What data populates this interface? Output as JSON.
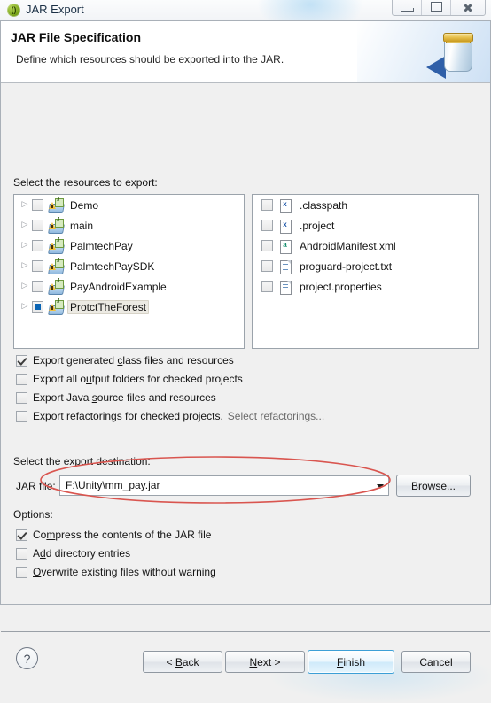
{
  "window": {
    "title": "JAR Export",
    "icon": "eclipse-icon",
    "controls": {
      "minimize": "minimize-button",
      "maximize": "restore-button",
      "close": "close-button"
    }
  },
  "header": {
    "title": "JAR File Specification",
    "description": "Define which resources should be exported into the JAR.",
    "icon": "jar-banner-icon"
  },
  "resources": {
    "label": "Select the resources to export:",
    "tree": [
      {
        "name": "Demo",
        "checked": false,
        "selected": false,
        "icon": "java-project-icon",
        "expander": "▷"
      },
      {
        "name": "main",
        "checked": false,
        "selected": false,
        "icon": "java-project-icon",
        "expander": "▷"
      },
      {
        "name": "PalmtechPay",
        "checked": false,
        "selected": false,
        "icon": "java-project-icon",
        "expander": "▷"
      },
      {
        "name": "PalmtechPaySDK",
        "checked": false,
        "selected": false,
        "icon": "java-project-icon",
        "expander": "▷"
      },
      {
        "name": "PayAndroidExample",
        "checked": false,
        "selected": false,
        "icon": "java-project-icon",
        "expander": "▷"
      },
      {
        "name": "ProtctTheForest",
        "checked": true,
        "selected": true,
        "icon": "java-project-icon",
        "expander": "▷"
      }
    ],
    "files": [
      {
        "name": ".classpath",
        "checked": false,
        "icon": "xml-file-icon"
      },
      {
        "name": ".project",
        "checked": false,
        "icon": "xml-file-icon"
      },
      {
        "name": "AndroidManifest.xml",
        "checked": false,
        "icon": "android-manifest-icon"
      },
      {
        "name": "proguard-project.txt",
        "checked": false,
        "icon": "text-file-icon"
      },
      {
        "name": "project.properties",
        "checked": false,
        "icon": "properties-file-icon"
      }
    ]
  },
  "export_options": [
    {
      "label": "Export generated class files and resources",
      "checked": true
    },
    {
      "label": "Export all output folders for checked projects",
      "checked": false
    },
    {
      "label": "Export Java source files and resources",
      "checked": false
    },
    {
      "label": "Export refactorings for checked projects.",
      "checked": false,
      "link": "Select refactorings..."
    }
  ],
  "destination": {
    "label": "Select the export destination:",
    "field_label": "JAR file:",
    "value": "F:\\Unity\\mm_pay.jar",
    "placeholder": "",
    "browse_label": "Browse...",
    "dropdown_icon": "chevron-down-icon",
    "annotation_color": "#d9554f"
  },
  "options": {
    "label": "Options:",
    "items": [
      {
        "label": "Compress the contents of the JAR file",
        "checked": true
      },
      {
        "label": "Add directory entries",
        "checked": false
      },
      {
        "label": "Overwrite existing files without warning",
        "checked": false
      }
    ]
  },
  "footer": {
    "help_icon": "help-icon",
    "back": "< Back",
    "next": "Next >",
    "finish": "Finish",
    "cancel": "Cancel",
    "default_button": "Finish",
    "accent_color": "#3c9fd6"
  }
}
